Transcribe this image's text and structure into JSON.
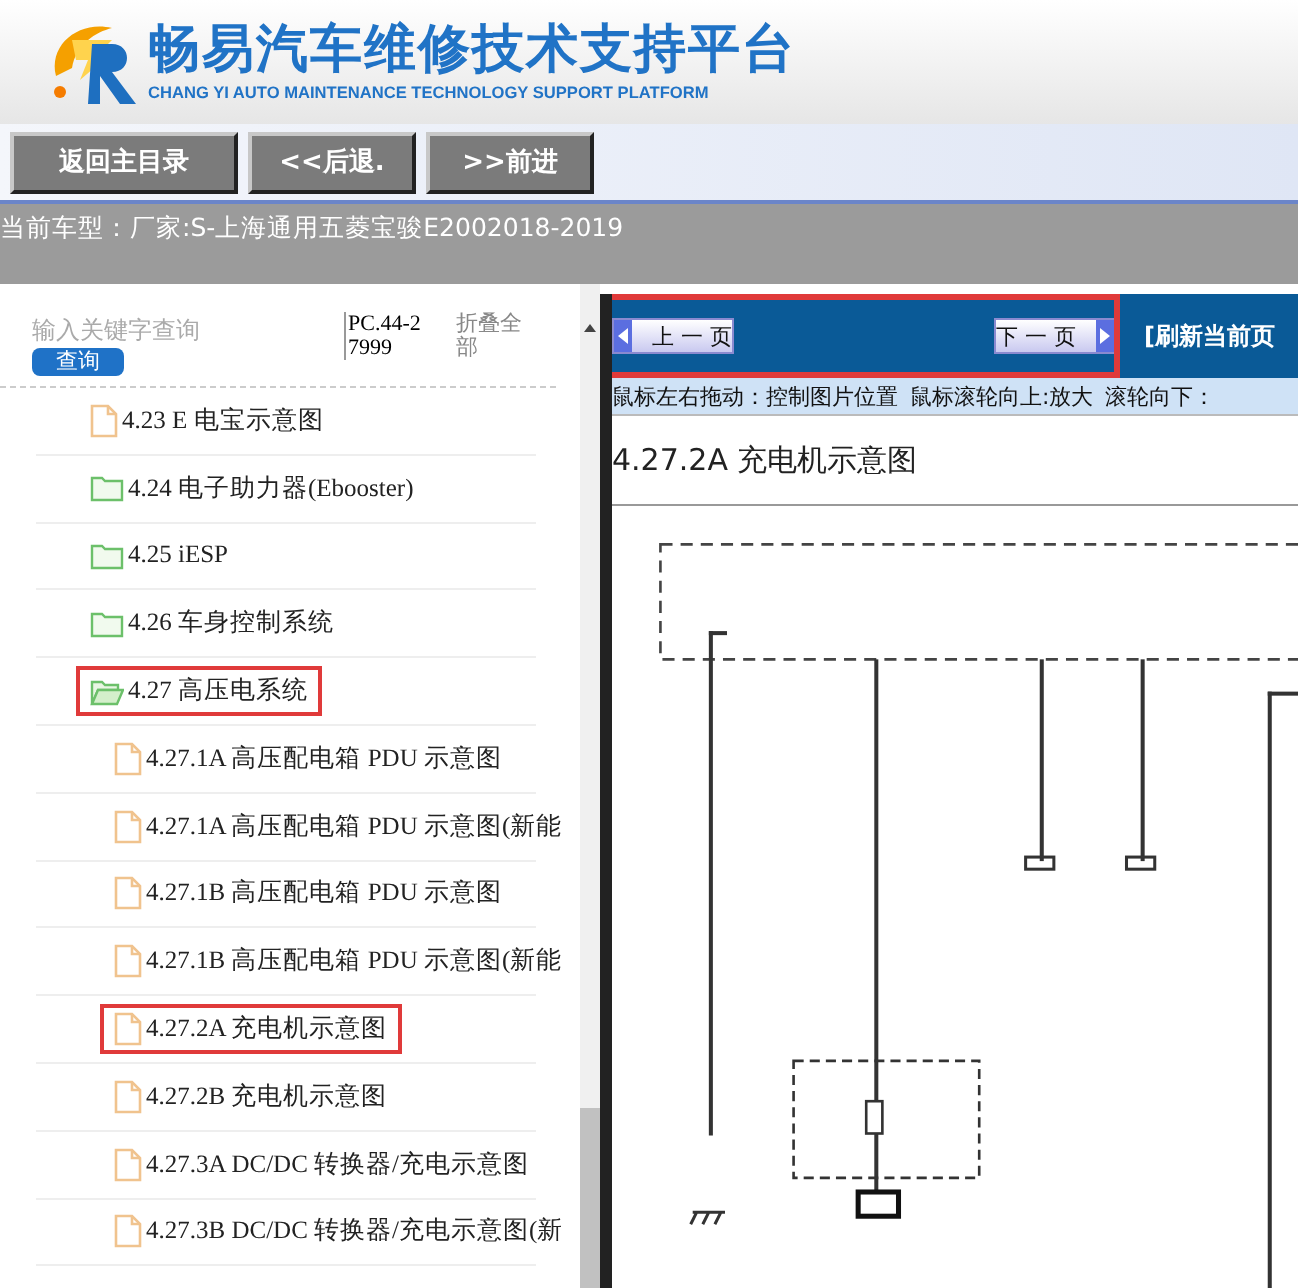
{
  "header": {
    "title": "畅易汽车维修技术支持平台",
    "subtitle": "CHANG YI AUTO MAINTENANCE TECHNOLOGY SUPPORT PLATFORM"
  },
  "nav": {
    "buttons": [
      "返回主目录",
      "<<后退.",
      ">>前进"
    ]
  },
  "vehicle_bar": {
    "label": "当前车型：",
    "value": "厂家:S-上海通用五菱宝骏E2002018-2019"
  },
  "search": {
    "placeholder": "输入关键字查询",
    "button": "查询",
    "code": "PC.44-27999",
    "collapse": "折叠全部"
  },
  "tree": [
    {
      "kind": "file",
      "label": "4.23 E 电宝示意图",
      "highlighted": false
    },
    {
      "kind": "folder",
      "label": "4.24 电子助力器(Ebooster)",
      "expanded": false,
      "highlighted": false
    },
    {
      "kind": "folder",
      "label": "4.25 iESP",
      "expanded": false,
      "highlighted": false
    },
    {
      "kind": "folder",
      "label": "4.26 车身控制系统",
      "expanded": false,
      "highlighted": false
    },
    {
      "kind": "folder",
      "label": "4.27 高压电系统",
      "expanded": true,
      "highlighted": true,
      "children": [
        {
          "kind": "file",
          "label": "4.27.1A 高压配电箱 PDU 示意图",
          "highlighted": false
        },
        {
          "kind": "file",
          "label": "4.27.1A 高压配电箱 PDU 示意图(新能",
          "highlighted": false
        },
        {
          "kind": "file",
          "label": "4.27.1B 高压配电箱 PDU 示意图",
          "highlighted": false
        },
        {
          "kind": "file",
          "label": "4.27.1B 高压配电箱 PDU 示意图(新能",
          "highlighted": false
        },
        {
          "kind": "file",
          "label": "4.27.2A 充电机示意图",
          "highlighted": true
        },
        {
          "kind": "file",
          "label": "4.27.2B 充电机示意图",
          "highlighted": false
        },
        {
          "kind": "file",
          "label": "4.27.3A DC/DC 转换器/充电示意图",
          "highlighted": false
        },
        {
          "kind": "file",
          "label": "4.27.3B DC/DC 转换器/充电示意图(新",
          "highlighted": false
        }
      ]
    }
  ],
  "viewer": {
    "prev_button": "上 一 页",
    "next_button": "下 一 页",
    "pager_highlighted": true,
    "refresh": "[刷新当前页",
    "hints": [
      "鼠标左右拖动：控制图片位置",
      "鼠标滚轮向上:放大",
      "滚轮向下："
    ],
    "title": "4.27.2A 充电机示意图",
    "diagram": {
      "kind": "picture"
    }
  }
}
